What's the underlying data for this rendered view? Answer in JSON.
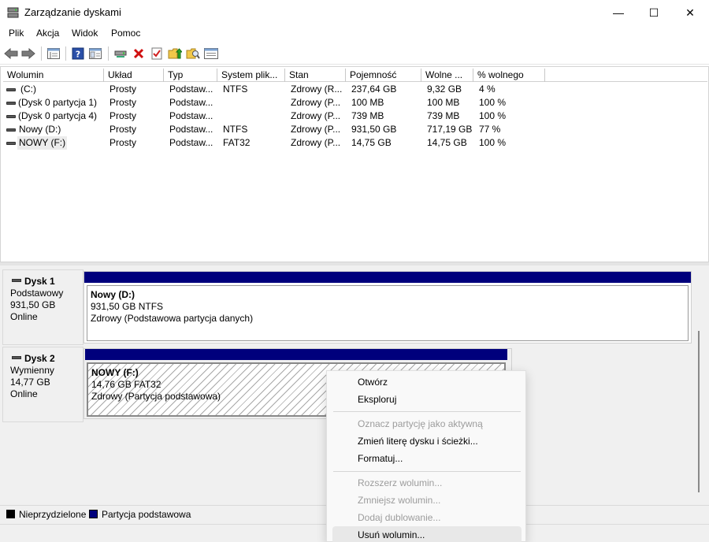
{
  "window": {
    "title": "Zarządzanie dyskami",
    "minimize_glyph": "—",
    "maximize_glyph": "☐",
    "close_glyph": "✕"
  },
  "menu": [
    "Plik",
    "Akcja",
    "Widok",
    "Pomoc"
  ],
  "toolbar_icons": [
    "back-arrow-icon",
    "forward-arrow-icon",
    "console-tree-icon",
    "help-icon",
    "show-hide-pane-icon",
    "connect-drive-icon",
    "delete-icon",
    "check-icon",
    "up-folder-icon",
    "search-folder-icon",
    "properties-icon"
  ],
  "table": {
    "headers": [
      "Wolumin",
      "Układ",
      "Typ",
      "System plik...",
      "Stan",
      "Pojemność",
      "Wolne ...",
      "% wolnego"
    ],
    "rows": [
      [
        "(C:)",
        "Prosty",
        "Podstaw...",
        "NTFS",
        "Zdrowy (R...",
        "237,64 GB",
        "9,32 GB",
        "4 %"
      ],
      [
        "(Dysk 0 partycja 1)",
        "Prosty",
        "Podstaw...",
        "",
        "Zdrowy (P...",
        "100 MB",
        "100 MB",
        "100 %"
      ],
      [
        "(Dysk 0 partycja 4)",
        "Prosty",
        "Podstaw...",
        "",
        "Zdrowy (P...",
        "739 MB",
        "739 MB",
        "100 %"
      ],
      [
        "Nowy (D:)",
        "Prosty",
        "Podstaw...",
        "NTFS",
        "Zdrowy (P...",
        "931,50 GB",
        "717,19 GB",
        "77 %"
      ],
      [
        "NOWY (F:)",
        "Prosty",
        "Podstaw...",
        "FAT32",
        "Zdrowy (P...",
        "14,75 GB",
        "14,75 GB",
        "100 %"
      ]
    ]
  },
  "disks": [
    {
      "name": "Dysk 1",
      "type": "Podstawowy",
      "size": "931,50 GB",
      "status": "Online",
      "partition": {
        "name": "Nowy  (D:)",
        "size_fs": "931,50 GB NTFS",
        "status": "Zdrowy (Podstawowa partycja danych)"
      }
    },
    {
      "name": "Dysk 2",
      "type": "Wymienny",
      "size": "14,77 GB",
      "status": "Online",
      "partition": {
        "name": "NOWY  (F:)",
        "size_fs": "14,76 GB FAT32",
        "status": "Zdrowy (Partycja podstawowa)"
      }
    }
  ],
  "legend": {
    "unallocated": "Nieprzydzielone",
    "primary": "Partycja podstawowa",
    "unallocated_color": "#000000",
    "primary_color": "#00007c"
  },
  "context_menu": {
    "open": "Otwórz",
    "explore": "Eksploruj",
    "mark_active": "Oznacz partycję jako aktywną",
    "change_letter": "Zmień literę dysku i ścieżki...",
    "format": "Formatuj...",
    "extend": "Rozszerz wolumin...",
    "shrink": "Zmniejsz wolumin...",
    "add_mirror": "Dodaj dublowanie...",
    "delete": "Usuń wolumin..."
  }
}
